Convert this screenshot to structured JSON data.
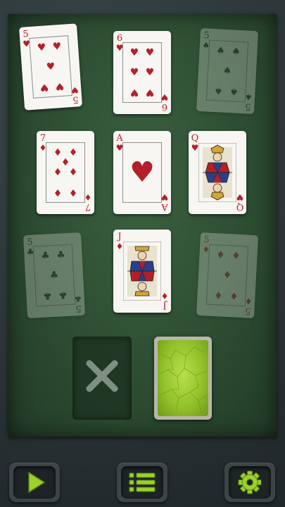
{
  "board": {
    "cards": [
      {
        "id": "c1",
        "rank": "5",
        "suit": "♥",
        "color": "red",
        "faded": false
      },
      {
        "id": "c2",
        "rank": "6",
        "suit": "♥",
        "color": "red",
        "faded": false
      },
      {
        "id": "c3",
        "rank": "5",
        "suit": "♠",
        "color": "black",
        "faded": true
      },
      {
        "id": "c4",
        "rank": "7",
        "suit": "♦",
        "color": "red",
        "faded": false
      },
      {
        "id": "c5",
        "rank": "A",
        "suit": "♥",
        "color": "red",
        "faded": false
      },
      {
        "id": "c6",
        "rank": "Q",
        "suit": "♥",
        "color": "red",
        "faded": false
      },
      {
        "id": "c7",
        "rank": "5",
        "suit": "♣",
        "color": "black",
        "faded": true
      },
      {
        "id": "c8",
        "rank": "J",
        "suit": "♦",
        "color": "red",
        "faded": false
      },
      {
        "id": "c9",
        "rank": "5",
        "suit": "♦",
        "color": "red",
        "faded": true
      }
    ]
  },
  "discard_slot": {
    "icon": "x-mark-icon"
  },
  "deck": {
    "icon": "card-back"
  },
  "toolbar": {
    "buttons": [
      {
        "icon": "play-icon",
        "color": "#9ad12b"
      },
      {
        "icon": "menu-icon",
        "color": "#9ad12b"
      },
      {
        "icon": "gear-icon",
        "color": "#9ad12b"
      }
    ]
  }
}
